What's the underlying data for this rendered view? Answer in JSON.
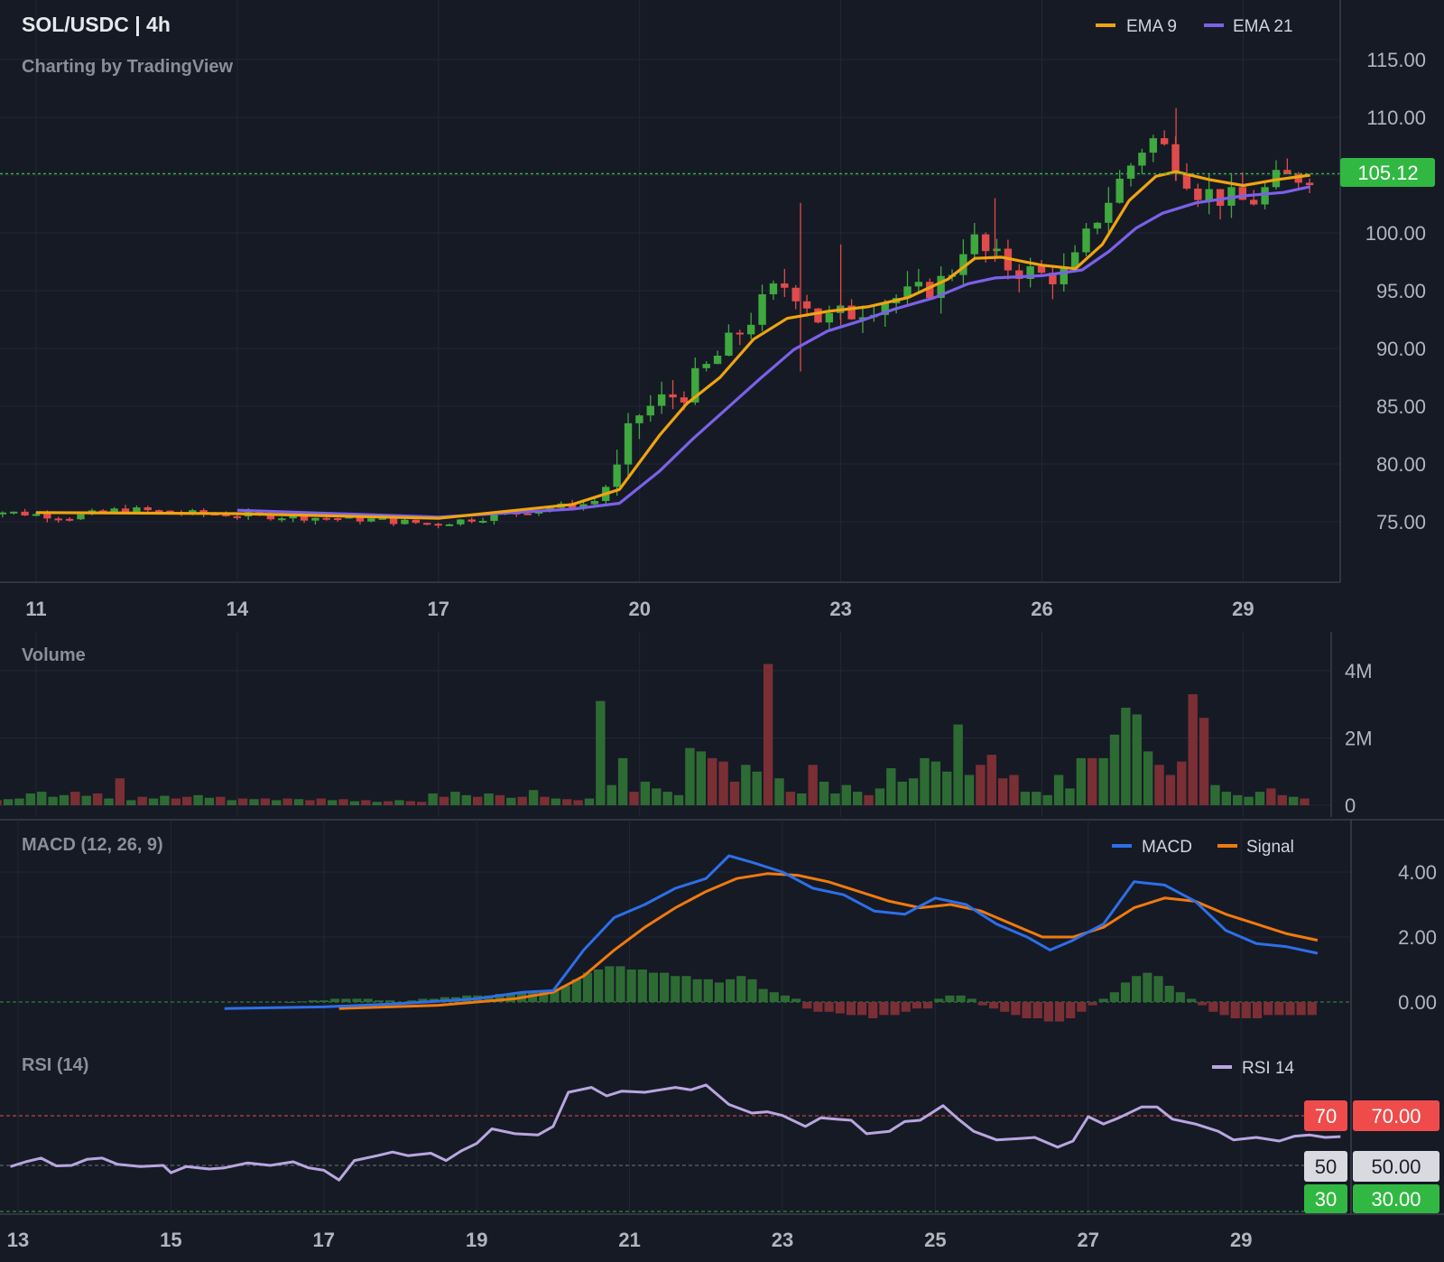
{
  "colors": {
    "background": "#161a25",
    "grid": "#232734",
    "axis_text": "#b2b5be",
    "up": "#3fa83f",
    "down": "#e04b4b",
    "vol_up": "#2e6b34",
    "vol_down": "#7a2f35",
    "ema9": "#f0a410",
    "ema21": "#7b61e8",
    "macd": "#2d6fe8",
    "signal": "#f07a10",
    "rsi": "#b9a6e0",
    "price_tag": "#31b842",
    "rsi70": "#f04b4b",
    "rsi50": "#d8dadf",
    "rsi30": "#31b842"
  },
  "header": {
    "title": "SOL/USDC | 4h",
    "credit": "Charting by TradingView",
    "current_price": "105.12"
  },
  "chart_data": [
    {
      "type": "candlestick",
      "title": "SOL/USDC | 4h",
      "legend": [
        {
          "name": "EMA 9",
          "color": "#f0a410"
        },
        {
          "name": "EMA 21",
          "color": "#7b61e8"
        }
      ],
      "legend_placement": "top-right",
      "x_ticks": [
        "11",
        "14",
        "17",
        "20",
        "23",
        "26",
        "29"
      ],
      "y_ticks": [
        "75.00",
        "80.00",
        "85.00",
        "90.00",
        "95.00",
        "100.00",
        "105.00",
        "110.00",
        "115.00"
      ],
      "ylim": [
        71.0,
        117.0
      ],
      "current_price": 105.12,
      "grid": true,
      "close_path": [
        [
          10.4,
          75.9
        ],
        [
          11.5,
          75.4
        ],
        [
          12.3,
          76.1
        ],
        [
          13.0,
          75.8
        ],
        [
          14.0,
          75.6
        ],
        [
          15.0,
          75.4
        ],
        [
          16.0,
          75.2
        ],
        [
          16.9,
          74.8
        ],
        [
          17.7,
          75.4
        ],
        [
          18.6,
          76.2
        ],
        [
          19.3,
          76.6
        ],
        [
          19.7,
          79.6
        ],
        [
          19.9,
          84.0
        ],
        [
          20.3,
          85.4
        ],
        [
          20.7,
          86.4
        ],
        [
          21.0,
          88.3
        ],
        [
          21.4,
          90.8
        ],
        [
          21.8,
          93.6
        ],
        [
          22.1,
          95.6
        ],
        [
          22.4,
          94.8
        ],
        [
          22.7,
          92.3
        ],
        [
          23.2,
          93.2
        ],
        [
          23.6,
          94.2
        ],
        [
          24.1,
          94.6
        ],
        [
          24.6,
          96.1
        ],
        [
          24.9,
          99.8
        ],
        [
          25.2,
          98.0
        ],
        [
          25.5,
          97.1
        ],
        [
          26.0,
          96.3
        ],
        [
          26.4,
          96.4
        ],
        [
          26.8,
          101.2
        ],
        [
          27.2,
          104.8
        ],
        [
          27.6,
          108.3
        ],
        [
          27.9,
          107.0
        ],
        [
          28.3,
          103.8
        ],
        [
          28.7,
          103.0
        ],
        [
          29.1,
          102.6
        ],
        [
          29.5,
          104.5
        ],
        [
          30.0,
          105.12
        ]
      ],
      "ema9": [
        [
          11.0,
          75.8
        ],
        [
          14.0,
          75.7
        ],
        [
          17.0,
          75.3
        ],
        [
          19.0,
          76.5
        ],
        [
          19.7,
          77.8
        ],
        [
          20.3,
          82.5
        ],
        [
          20.7,
          85.2
        ],
        [
          21.2,
          87.5
        ],
        [
          21.7,
          90.8
        ],
        [
          22.2,
          92.6
        ],
        [
          22.8,
          93.2
        ],
        [
          23.4,
          93.6
        ],
        [
          24.0,
          94.4
        ],
        [
          24.6,
          96.0
        ],
        [
          25.0,
          97.8
        ],
        [
          25.4,
          97.9
        ],
        [
          26.0,
          97.2
        ],
        [
          26.5,
          96.9
        ],
        [
          26.9,
          99.0
        ],
        [
          27.3,
          102.8
        ],
        [
          27.7,
          104.9
        ],
        [
          28.0,
          105.3
        ],
        [
          28.5,
          104.6
        ],
        [
          29.0,
          104.1
        ],
        [
          29.5,
          104.6
        ],
        [
          30.0,
          105.0
        ]
      ],
      "ema21": [
        [
          14.0,
          76.0
        ],
        [
          17.0,
          75.4
        ],
        [
          19.0,
          76.1
        ],
        [
          19.7,
          76.6
        ],
        [
          20.3,
          79.4
        ],
        [
          20.8,
          82.2
        ],
        [
          21.3,
          84.8
        ],
        [
          21.8,
          87.4
        ],
        [
          22.3,
          89.9
        ],
        [
          22.8,
          91.5
        ],
        [
          23.3,
          92.4
        ],
        [
          23.8,
          93.4
        ],
        [
          24.4,
          94.4
        ],
        [
          24.9,
          95.6
        ],
        [
          25.3,
          96.1
        ],
        [
          26.0,
          96.3
        ],
        [
          26.6,
          96.8
        ],
        [
          27.0,
          98.4
        ],
        [
          27.4,
          100.4
        ],
        [
          27.8,
          101.7
        ],
        [
          28.3,
          102.6
        ],
        [
          29.0,
          103.2
        ],
        [
          29.6,
          103.5
        ],
        [
          30.0,
          104.0
        ]
      ],
      "notable_wicks": [
        {
          "x": 22.4,
          "high": 102.6,
          "low": 88.0
        },
        {
          "x": 23.0,
          "high": 99.0,
          "low": 92.0
        },
        {
          "x": 25.3,
          "high": 103.0,
          "low": 97.5
        },
        {
          "x": 28.0,
          "high": 110.8,
          "low": 104.5
        }
      ]
    },
    {
      "type": "bar",
      "title": "Volume",
      "y_ticks": [
        "0",
        "2M",
        "4M"
      ],
      "ylim": [
        0,
        4200000
      ],
      "x_range": [
        10.0,
        30.0
      ],
      "values": [
        300000,
        200000,
        150000,
        180000,
        200000,
        350000,
        400000,
        250000,
        300000,
        400000,
        280000,
        350000,
        200000,
        800000,
        150000,
        250000,
        200000,
        280000,
        200000,
        250000,
        300000,
        220000,
        250000,
        150000,
        200000,
        180000,
        200000,
        150000,
        200000,
        180000,
        150000,
        200000,
        150000,
        180000,
        120000,
        150000,
        100000,
        120000,
        150000,
        120000,
        100000,
        350000,
        250000,
        400000,
        300000,
        250000,
        350000,
        300000,
        220000,
        250000,
        450000,
        250000,
        200000,
        180000,
        150000,
        200000,
        3100000,
        600000,
        1400000,
        400000,
        700000,
        500000,
        400000,
        300000,
        1700000,
        1600000,
        1400000,
        1300000,
        700000,
        1200000,
        1000000,
        4200000,
        800000,
        400000,
        350000,
        1200000,
        700000,
        350000,
        600000,
        400000,
        300000,
        500000,
        1100000,
        700000,
        800000,
        1400000,
        1300000,
        1000000,
        2400000,
        900000,
        1200000,
        1500000,
        800000,
        900000,
        400000,
        400000,
        300000,
        900000,
        500000,
        1400000,
        1400000,
        1400000,
        2100000,
        2900000,
        2700000,
        1600000,
        1200000,
        900000,
        1300000,
        3300000,
        2600000,
        600000,
        400000,
        300000,
        250000,
        400000,
        500000,
        300000,
        250000,
        200000
      ],
      "directions": [
        "d",
        "d",
        "d",
        "u",
        "u",
        "u",
        "u",
        "u",
        "u",
        "d",
        "u",
        "d",
        "u",
        "d",
        "u",
        "d",
        "u",
        "u",
        "d",
        "d",
        "u",
        "u",
        "d",
        "u",
        "d",
        "u",
        "d",
        "u",
        "d",
        "u",
        "d",
        "d",
        "u",
        "d",
        "u",
        "d",
        "u",
        "d",
        "u",
        "d",
        "d",
        "u",
        "d",
        "u",
        "u",
        "d",
        "u",
        "d",
        "u",
        "d",
        "u",
        "d",
        "u",
        "d",
        "d",
        "u",
        "u",
        "u",
        "u",
        "d",
        "u",
        "u",
        "u",
        "u",
        "u",
        "u",
        "d",
        "d",
        "d",
        "u",
        "u",
        "d",
        "u",
        "d",
        "u",
        "d",
        "u",
        "u",
        "u",
        "u",
        "d",
        "u",
        "u",
        "u",
        "u",
        "u",
        "u",
        "u",
        "u",
        "u",
        "d",
        "d",
        "d",
        "d",
        "u",
        "u",
        "u",
        "u",
        "u",
        "u",
        "d",
        "u",
        "u",
        "u",
        "u",
        "u",
        "d",
        "d",
        "d",
        "d",
        "d",
        "u",
        "u",
        "u",
        "u",
        "u",
        "d",
        "d",
        "u",
        "d"
      ]
    },
    {
      "type": "line",
      "title": "MACD (12, 26, 9)",
      "legend": [
        {
          "name": "MACD",
          "color": "#2d6fe8"
        },
        {
          "name": "Signal",
          "color": "#f07a10"
        }
      ],
      "legend_placement": "top-right",
      "y_ticks": [
        "0.00",
        "2.00",
        "4.00"
      ],
      "ylim": [
        -1.2,
        5.0
      ],
      "macd": [
        [
          15.7,
          -0.2
        ],
        [
          17.0,
          -0.15
        ],
        [
          18.0,
          -0.05
        ],
        [
          19.0,
          0.1
        ],
        [
          19.6,
          0.3
        ],
        [
          20.0,
          0.35
        ],
        [
          20.4,
          1.6
        ],
        [
          20.8,
          2.6
        ],
        [
          21.2,
          3.0
        ],
        [
          21.6,
          3.5
        ],
        [
          22.0,
          3.8
        ],
        [
          22.3,
          4.5
        ],
        [
          22.6,
          4.3
        ],
        [
          23.0,
          4.0
        ],
        [
          23.4,
          3.5
        ],
        [
          23.8,
          3.3
        ],
        [
          24.2,
          2.8
        ],
        [
          24.6,
          2.7
        ],
        [
          25.0,
          3.2
        ],
        [
          25.4,
          3.0
        ],
        [
          25.8,
          2.4
        ],
        [
          26.2,
          2.0
        ],
        [
          26.5,
          1.6
        ],
        [
          26.8,
          1.9
        ],
        [
          27.2,
          2.4
        ],
        [
          27.6,
          3.7
        ],
        [
          28.0,
          3.6
        ],
        [
          28.4,
          3.1
        ],
        [
          28.8,
          2.2
        ],
        [
          29.2,
          1.8
        ],
        [
          29.6,
          1.7
        ],
        [
          30.0,
          1.5
        ]
      ],
      "signal": [
        [
          17.2,
          -0.2
        ],
        [
          18.5,
          -0.1
        ],
        [
          19.5,
          0.1
        ],
        [
          20.0,
          0.3
        ],
        [
          20.4,
          0.8
        ],
        [
          20.8,
          1.6
        ],
        [
          21.2,
          2.3
        ],
        [
          21.6,
          2.9
        ],
        [
          22.0,
          3.4
        ],
        [
          22.4,
          3.8
        ],
        [
          22.8,
          3.95
        ],
        [
          23.2,
          3.9
        ],
        [
          23.6,
          3.7
        ],
        [
          24.0,
          3.4
        ],
        [
          24.4,
          3.1
        ],
        [
          24.8,
          2.9
        ],
        [
          25.2,
          3.0
        ],
        [
          25.6,
          2.8
        ],
        [
          26.0,
          2.4
        ],
        [
          26.4,
          2.0
        ],
        [
          26.8,
          2.0
        ],
        [
          27.2,
          2.3
        ],
        [
          27.6,
          2.9
        ],
        [
          28.0,
          3.2
        ],
        [
          28.4,
          3.1
        ],
        [
          28.8,
          2.7
        ],
        [
          29.2,
          2.4
        ],
        [
          29.6,
          2.1
        ],
        [
          30.0,
          1.9
        ]
      ],
      "histogram_range": [
        16.5,
        30.0
      ],
      "histogram": [
        0.0,
        0.02,
        0.05,
        0.05,
        0.1,
        0.1,
        0.1,
        0.1,
        0.05,
        0.05,
        0.0,
        0.05,
        0.1,
        0.1,
        0.15,
        0.15,
        0.2,
        0.2,
        0.2,
        0.25,
        0.25,
        0.3,
        0.3,
        0.3,
        0.35,
        0.5,
        0.7,
        0.9,
        1.0,
        1.1,
        1.1,
        1.0,
        1.0,
        0.9,
        0.9,
        0.8,
        0.8,
        0.7,
        0.7,
        0.6,
        0.7,
        0.8,
        0.7,
        0.4,
        0.3,
        0.2,
        0.1,
        -0.2,
        -0.3,
        -0.3,
        -0.35,
        -0.4,
        -0.4,
        -0.5,
        -0.4,
        -0.4,
        -0.3,
        -0.2,
        -0.2,
        0.1,
        0.2,
        0.2,
        0.1,
        -0.1,
        -0.2,
        -0.3,
        -0.4,
        -0.5,
        -0.5,
        -0.6,
        -0.6,
        -0.5,
        -0.3,
        -0.1,
        0.1,
        0.3,
        0.6,
        0.8,
        0.9,
        0.8,
        0.5,
        0.3,
        0.1,
        -0.1,
        -0.3,
        -0.4,
        -0.5,
        -0.5,
        -0.5,
        -0.4,
        -0.4,
        -0.4,
        -0.4,
        -0.4
      ]
    },
    {
      "type": "line",
      "title": "RSI (14)",
      "legend": [
        {
          "name": "RSI 14",
          "color": "#b9a6e0"
        }
      ],
      "legend_placement": "top-right",
      "y_ticks": [
        "30.00",
        "50.00",
        "70.00"
      ],
      "levels": [
        {
          "value": "70",
          "axis": "70.00"
        },
        {
          "value": "50",
          "axis": "50.00"
        },
        {
          "value": "30",
          "axis": "30.00"
        }
      ],
      "ylim": [
        29.5,
        86.0
      ],
      "x_ticks": [
        "13",
        "15",
        "17",
        "19",
        "21",
        "23",
        "25",
        "27",
        "29"
      ],
      "rsi": [
        [
          12.9,
          49.5
        ],
        [
          13.1,
          51.5
        ],
        [
          13.3,
          53.0
        ],
        [
          13.5,
          49.8
        ],
        [
          13.7,
          50.0
        ],
        [
          13.9,
          52.5
        ],
        [
          14.1,
          53.0
        ],
        [
          14.3,
          50.5
        ],
        [
          14.6,
          49.5
        ],
        [
          14.9,
          50.0
        ],
        [
          15.0,
          47.0
        ],
        [
          15.2,
          49.5
        ],
        [
          15.5,
          48.5
        ],
        [
          15.7,
          49.0
        ],
        [
          16.0,
          51.0
        ],
        [
          16.3,
          50.0
        ],
        [
          16.6,
          51.5
        ],
        [
          16.8,
          49.0
        ],
        [
          17.0,
          48.0
        ],
        [
          17.2,
          44.0
        ],
        [
          17.4,
          52.0
        ],
        [
          17.7,
          54.0
        ],
        [
          17.9,
          55.5
        ],
        [
          18.1,
          54.0
        ],
        [
          18.4,
          55.0
        ],
        [
          18.6,
          52.0
        ],
        [
          18.8,
          56.0
        ],
        [
          19.0,
          59.0
        ],
        [
          19.2,
          65.0
        ],
        [
          19.5,
          63.0
        ],
        [
          19.8,
          62.5
        ],
        [
          20.0,
          66.0
        ],
        [
          20.2,
          80.0
        ],
        [
          20.5,
          82.0
        ],
        [
          20.7,
          78.5
        ],
        [
          20.9,
          80.5
        ],
        [
          21.2,
          80.0
        ],
        [
          21.4,
          81.0
        ],
        [
          21.6,
          82.0
        ],
        [
          21.8,
          81.0
        ],
        [
          22.0,
          83.0
        ],
        [
          22.3,
          75.0
        ],
        [
          22.6,
          71.5
        ],
        [
          22.8,
          72.0
        ],
        [
          23.0,
          70.5
        ],
        [
          23.3,
          66.0
        ],
        [
          23.5,
          69.5
        ],
        [
          23.7,
          69.0
        ],
        [
          23.9,
          68.5
        ],
        [
          24.1,
          63.0
        ],
        [
          24.4,
          64.0
        ],
        [
          24.6,
          68.0
        ],
        [
          24.8,
          68.5
        ],
        [
          25.1,
          74.5
        ],
        [
          25.3,
          69.0
        ],
        [
          25.5,
          64.0
        ],
        [
          25.8,
          60.5
        ],
        [
          26.1,
          61.0
        ],
        [
          26.3,
          61.5
        ],
        [
          26.6,
          57.5
        ],
        [
          26.8,
          60.0
        ],
        [
          27.0,
          70.0
        ],
        [
          27.2,
          67.0
        ],
        [
          27.4,
          69.5
        ],
        [
          27.7,
          74.0
        ],
        [
          27.9,
          74.0
        ],
        [
          28.1,
          69.0
        ],
        [
          28.4,
          67.0
        ],
        [
          28.7,
          64.0
        ],
        [
          28.9,
          60.5
        ],
        [
          29.2,
          61.5
        ],
        [
          29.5,
          60.0
        ],
        [
          29.7,
          62.0
        ],
        [
          29.9,
          62.5
        ],
        [
          30.1,
          61.5
        ],
        [
          30.3,
          61.8
        ]
      ]
    }
  ]
}
